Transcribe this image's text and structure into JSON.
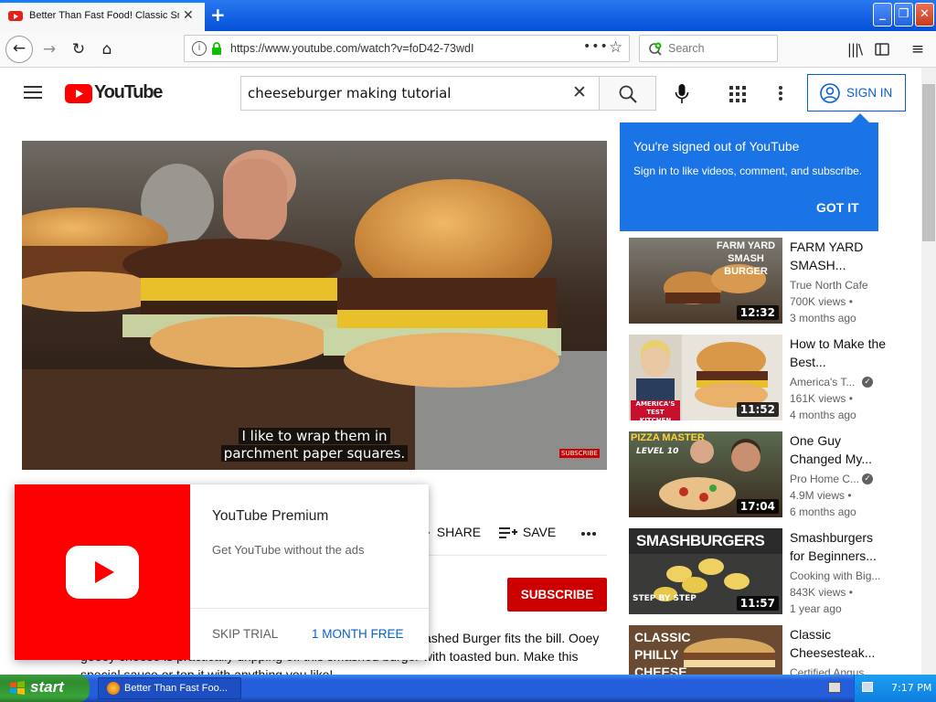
{
  "browser": {
    "tab_title": "Better Than Fast Food! Classic Sm",
    "url": "https://www.youtube.com/watch?v=foD42-73wdI",
    "search_placeholder": "Search"
  },
  "youtube": {
    "logo_text": "YouTube",
    "search_query": "cheeseburger making tutorial",
    "sign_in_label": "SIGN IN"
  },
  "tooltip": {
    "title": "You're signed out of YouTube",
    "body": "Sign in to like videos, comment, and subscribe.",
    "button": "GOT IT"
  },
  "video": {
    "caption_line1": "I like to wrap them in",
    "caption_line2": "parchment paper squares.",
    "watermark": "SUBSCRIBE"
  },
  "actions": {
    "share": "SHARE",
    "save": "SAVE",
    "subscribe": "SUBSCRIBE"
  },
  "description": {
    "line1": "ashed Burger fits the bill. Ooey",
    "line2": "gooey cheese is practically dripping off this smashed burger with toasted bun. Make this",
    "line3": "special sauce or top it with anything you like!"
  },
  "promo": {
    "title": "YouTube Premium",
    "subtitle": "Get YouTube without the ads",
    "skip": "SKIP TRIAL",
    "cta": "1 MONTH FREE"
  },
  "recommendations": [
    {
      "thumb_text": "FARM YARD SMASH BURGER",
      "duration": "12:32",
      "title": "FARM YARD SMASH...",
      "channel": "True North Cafe",
      "views": "700K views •",
      "age": "3 months ago",
      "verified": false
    },
    {
      "thumb_text": "AMERICA'S TEST KITCHEN",
      "duration": "11:52",
      "title": "How to Make the Best...",
      "channel": "America's T...",
      "views": "161K views •",
      "age": "4 months ago",
      "verified": true
    },
    {
      "thumb_text": "PIZZA MASTER",
      "thumb_text2": "LEVEL 10",
      "duration": "17:04",
      "title": "One Guy Changed My...",
      "channel": "Pro Home C...",
      "views": "4.9M views •",
      "age": "6 months ago",
      "verified": true
    },
    {
      "thumb_text": "SMASHBURGERS",
      "thumb_text2": "STEP BY STEP",
      "duration": "11:57",
      "title": "Smashburgers for Beginners...",
      "channel": "Cooking with Big...",
      "views": "843K views •",
      "age": "1 year ago",
      "verified": false
    },
    {
      "thumb_text": "CLASSIC PHILLY CHEESE",
      "duration": "",
      "title": "Classic Cheesesteak...",
      "channel": "Certified Angus",
      "views": "",
      "age": "",
      "verified": false
    }
  ],
  "taskbar": {
    "start": "start",
    "task": "Better Than Fast Foo...",
    "clock": "7:17 PM"
  },
  "colors": {
    "youtube_red": "#ff0000",
    "link_blue": "#065fd4",
    "tooltip_blue": "#1b74e6",
    "subscribe_red": "#cc0000",
    "xp_blue": "#245edb",
    "xp_green": "#3c9a3c"
  }
}
